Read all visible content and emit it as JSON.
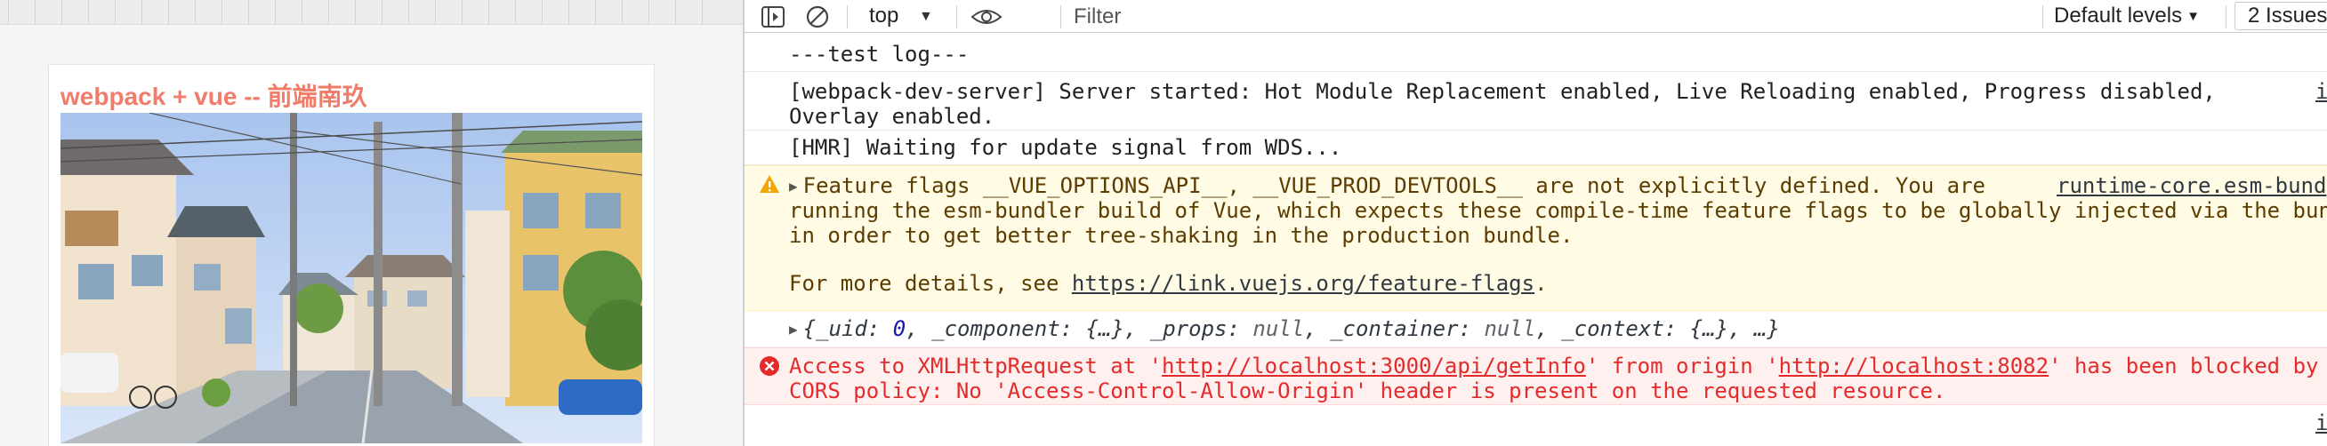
{
  "preview": {
    "title": "webpack + vue -- 前端南玖"
  },
  "toolbar": {
    "context": "top",
    "filter_placeholder": "Filter",
    "levels_label": "Default levels",
    "issues_label": "2 Issues"
  },
  "console": {
    "messages": [
      {
        "type": "log",
        "text": "---test log---"
      },
      {
        "type": "log",
        "text": "[webpack-dev-server] Server started: Hot Module Replacement enabled, Live Reloading enabled, Progress disabled,",
        "text2": "Overlay enabled.",
        "source": "i"
      },
      {
        "type": "log",
        "text": "[HMR] Waiting for update signal from WDS..."
      },
      {
        "type": "warning",
        "line1": "Feature flags __VUE_OPTIONS_API__, __VUE_PROD_DEVTOOLS__ are not explicitly defined. You are",
        "line2": "running the esm-bundler build of Vue, which expects these compile-time feature flags to be globally injected via the bun",
        "line3": "in order to get better tree-shaking in the production bundle.",
        "line4_prefix": "For more details, see ",
        "line4_link": "https://link.vuejs.org/feature-flags",
        "line4_suffix": ".",
        "source": "runtime-core.esm-bund"
      },
      {
        "type": "object",
        "parts": {
          "open": "{",
          "uid_key": "_uid: ",
          "uid_val": "0",
          "component": ", _component: {…}, _props: ",
          "props_val": "null",
          "container": ", _container: ",
          "container_val": "null",
          "rest": ", _context: {…}, …}"
        }
      },
      {
        "type": "error",
        "prefix": "Access to XMLHttpRequest at '",
        "url1": "http://localhost:3000/api/getInfo",
        "mid": "' from origin '",
        "url2": "http://localhost:8082",
        "suffix": "' has been blocked by",
        "line2": "CORS policy: No 'Access-Control-Allow-Origin' header is present on the requested resource."
      }
    ],
    "trailing_source": "i"
  },
  "colors": {
    "title_accent": "#f07c69",
    "warning_bg": "#fffbe5",
    "error_bg": "#fff0f0",
    "error_text": "#e42b2b"
  }
}
